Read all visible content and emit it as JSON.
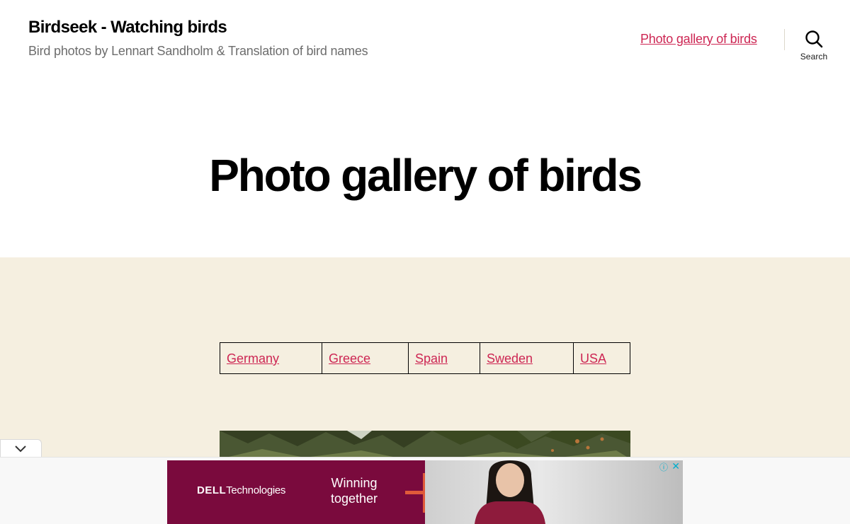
{
  "header": {
    "site_title": "Birdseek - Watching birds",
    "site_description": "Bird photos by Lennart Sandholm & Translation of bird names",
    "nav_link": "Photo gallery of birds",
    "search_label": "Search"
  },
  "hero": {
    "title": "Photo gallery of birds"
  },
  "countries": [
    {
      "label": "Germany"
    },
    {
      "label": "Greece"
    },
    {
      "label": "Spain"
    },
    {
      "label": "Sweden"
    },
    {
      "label": "USA"
    }
  ],
  "ad": {
    "brand_bold": "DELL",
    "brand_rest": "Technologies",
    "tagline_line1": "Winning",
    "tagline_line2": "together",
    "info_glyph": "ⓘ",
    "close_glyph": "✕"
  },
  "colors": {
    "link": "#cd2653",
    "content_background": "#f5efe0",
    "ad_brand": "#7a0a3d",
    "ad_accent": "#e05a3a"
  },
  "icons": {
    "search": "search-icon",
    "collapse": "chevron-down-icon",
    "ad_info": "info-icon",
    "ad_close": "close-icon"
  }
}
